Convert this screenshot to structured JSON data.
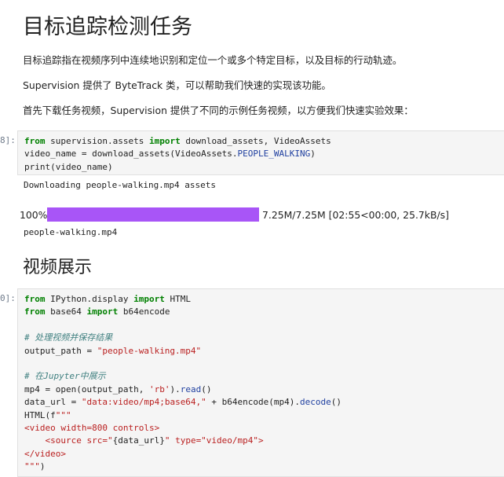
{
  "doc": {
    "title": "目标追踪检测任务",
    "para1": "目标追踪指在视频序列中连续地识别和定位一个或多个特定目标，以及目标的行动轨迹。",
    "para2": "Supervision 提供了 ByteTrack 类，可以帮助我们快速的实现该功能。",
    "para3": "首先下载任务视频，Supervision 提供了不同的示例任务视频，以方便我们快速实验效果：",
    "section_title": "视频展示"
  },
  "cell1": {
    "prompt": "8]:",
    "lines": [
      [
        {
          "t": "from",
          "c": "kw"
        },
        {
          "t": " supervision.assets "
        },
        {
          "t": "import",
          "c": "kw"
        },
        {
          "t": " download_assets, VideoAssets"
        }
      ],
      [
        {
          "t": "video_name = download_assets(VideoAssets."
        },
        {
          "t": "PEOPLE_WALKING",
          "c": "attr"
        },
        {
          "t": ")"
        }
      ],
      [
        {
          "t": "print(video_name)"
        }
      ]
    ],
    "output_download": "Downloading people-walking.mp4 assets",
    "progress": {
      "percent_label": "100%",
      "fraction": 1.0,
      "info": "7.25M/7.25M [02:55<00:00, 25.7kB/s]",
      "color": "#a855f7"
    },
    "output_file": "people-walking.mp4"
  },
  "cell2": {
    "prompt": "0]:",
    "lines": [
      [
        {
          "t": "from",
          "c": "kw"
        },
        {
          "t": " IPython.display "
        },
        {
          "t": "import",
          "c": "kw"
        },
        {
          "t": " HTML"
        }
      ],
      [
        {
          "t": "from",
          "c": "kw"
        },
        {
          "t": " base64 "
        },
        {
          "t": "import",
          "c": "kw"
        },
        {
          "t": " b64encode"
        }
      ],
      [],
      [
        {
          "t": "# 处理视频并保存结果",
          "c": "cm"
        }
      ],
      [
        {
          "t": "output_path = "
        },
        {
          "t": "\"people-walking.mp4\"",
          "c": "str"
        }
      ],
      [],
      [
        {
          "t": "# 在Jupyter中展示",
          "c": "cm"
        }
      ],
      [
        {
          "t": "mp4 = open(output_path, "
        },
        {
          "t": "'rb'",
          "c": "str"
        },
        {
          "t": ")."
        },
        {
          "t": "read",
          "c": "attr"
        },
        {
          "t": "()"
        }
      ],
      [
        {
          "t": "data_url = "
        },
        {
          "t": "\"data:video/mp4;base64,\"",
          "c": "str"
        },
        {
          "t": " + b64encode(mp4)."
        },
        {
          "t": "decode",
          "c": "attr"
        },
        {
          "t": "()"
        }
      ],
      [
        {
          "t": "HTML(f"
        },
        {
          "t": "\"\"\"",
          "c": "str"
        }
      ],
      [
        {
          "t": "<video width=800 controls>",
          "c": "str"
        }
      ],
      [
        {
          "t": "    <source src=\"",
          "c": "str"
        },
        {
          "t": "{data_url}"
        },
        {
          "t": "\" type=\"video/mp4\">",
          "c": "str"
        }
      ],
      [
        {
          "t": "</video>",
          "c": "str"
        }
      ],
      [
        {
          "t": "\"\"\"",
          "c": "str"
        },
        {
          "t": ")"
        }
      ]
    ]
  }
}
